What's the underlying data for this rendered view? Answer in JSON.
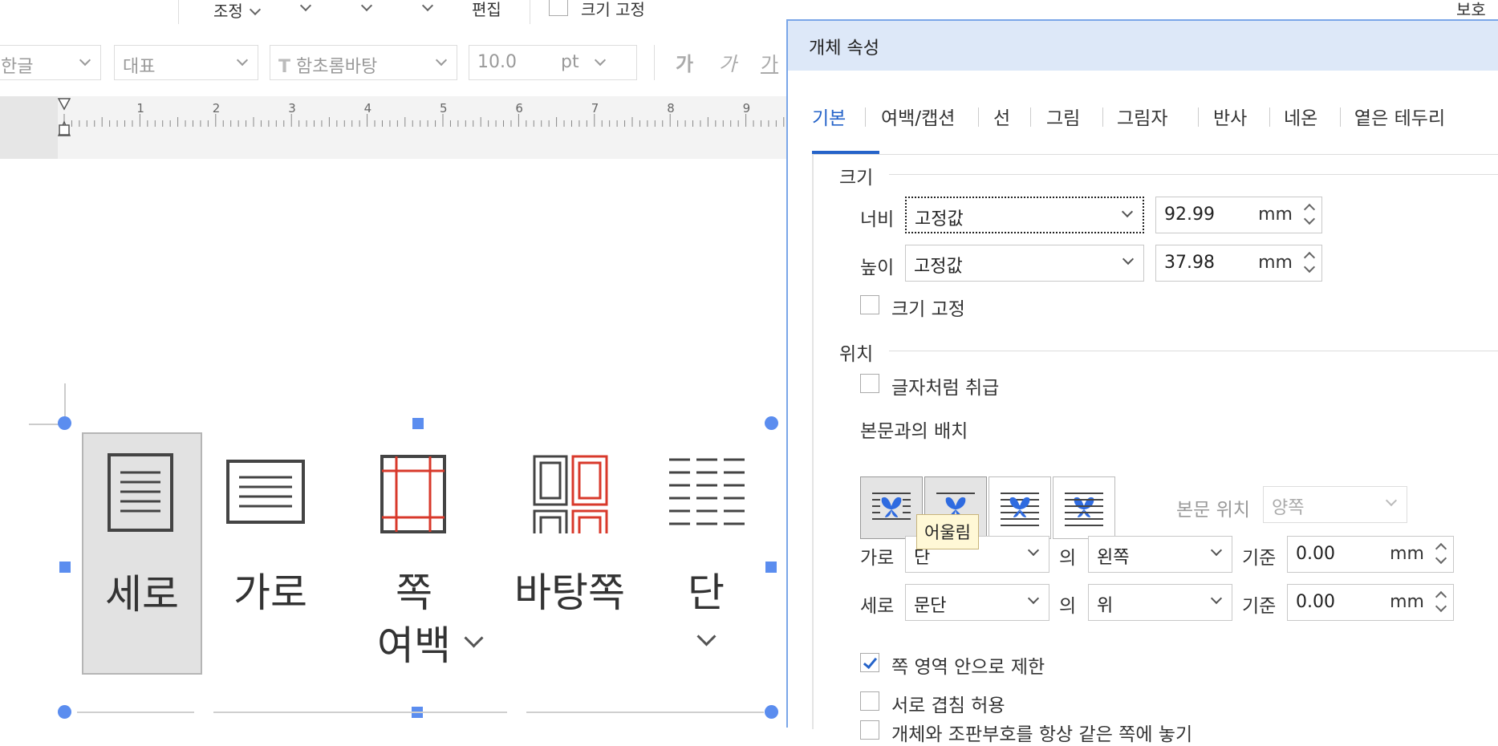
{
  "toolbar": {
    "adjust_label": "조정",
    "edit_label": "편집",
    "lock_size_label": "크기 고정",
    "protect_label": "보호",
    "lang_value": "한글",
    "style_value": "대표",
    "font_value": "함초롬바탕",
    "size_value": "10.0",
    "size_unit": "pt",
    "char_bold": "가",
    "char_italic": "가",
    "char_under": "가"
  },
  "ruler": {
    "ticks": [
      "1",
      "2",
      "3",
      "4",
      "5",
      "6",
      "7",
      "8",
      "9"
    ]
  },
  "page_tools": {
    "vertical": "세로",
    "horizontal": "가로",
    "margin_line1": "쪽",
    "margin_line2": "여백",
    "master_page": "바탕쪽",
    "columns": "단"
  },
  "dialog": {
    "title": "개체 속성",
    "tabs": [
      "기본",
      "여백/캡션",
      "선",
      "그림",
      "그림자",
      "반사",
      "네온",
      "옅은 테두리"
    ],
    "size_section": "크기",
    "width_label": "너비",
    "width_mode": "고정값",
    "width_value": "92.99",
    "height_label": "높이",
    "height_mode": "고정값",
    "height_value": "37.98",
    "unit": "mm",
    "lock_size": "크기 고정",
    "position_section": "위치",
    "treat_as_char": "글자처럼 취급",
    "text_wrap_label": "본문과의 배치",
    "text_pos_label": "본문 위치",
    "text_pos_value": "양쪽",
    "tooltip": "어울림",
    "horiz_label": "가로",
    "horiz_ref": "단",
    "of": "의",
    "horiz_align": "왼쪽",
    "basis": "기준",
    "horiz_offset": "0.00",
    "vert_label": "세로",
    "vert_ref": "문단",
    "vert_align": "위",
    "vert_offset": "0.00",
    "limit_in_page": "쪽 영역 안으로 제한",
    "allow_overlap": "서로 겹침 허용",
    "keep_same_page": "개체와 조판부호를 항상 같은 쪽에 놓기"
  }
}
